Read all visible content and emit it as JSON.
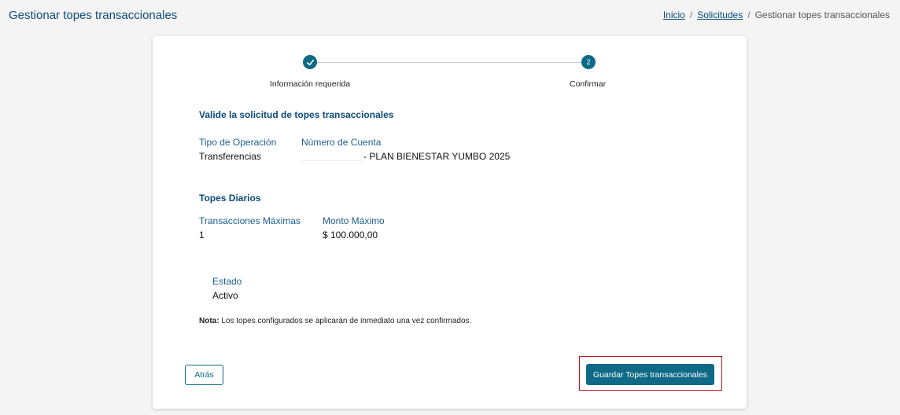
{
  "header": {
    "title": "Gestionar topes transaccionales"
  },
  "breadcrumb": {
    "home": "Inicio",
    "requests": "Solicitudes",
    "current": "Gestionar topes transaccionales"
  },
  "stepper": {
    "steps": [
      {
        "label": "Información requerida",
        "state": "done",
        "icon": "check-icon"
      },
      {
        "label": "Confirmar",
        "number": "2",
        "state": "active"
      }
    ]
  },
  "validation": {
    "title": "Valide la solicitud de topes transaccionales",
    "operation_type_label": "Tipo de Operación",
    "operation_type_value": "Transferencias",
    "account_label": "Número de Cuenta",
    "account_value": "- PLAN BIENESTAR YUMBO 2025"
  },
  "daily_limits": {
    "title": "Topes Diarios",
    "max_tx_label": "Transacciones Máximas",
    "max_tx_value": "1",
    "max_amount_label": "Monto Máximo",
    "max_amount_value": "$ 100.000,00"
  },
  "status": {
    "label": "Estado",
    "value": "Activo"
  },
  "note": {
    "prefix": "Nota:",
    "text": " Los topes configurados se aplicarán de inmediato una vez confirmados."
  },
  "actions": {
    "back_label": "Atrás",
    "save_label": "Guardar Topes transaccionales"
  },
  "colors": {
    "primary": "#0e6a86",
    "title_blue": "#0b4a7a",
    "highlight_red": "#c0161c"
  }
}
